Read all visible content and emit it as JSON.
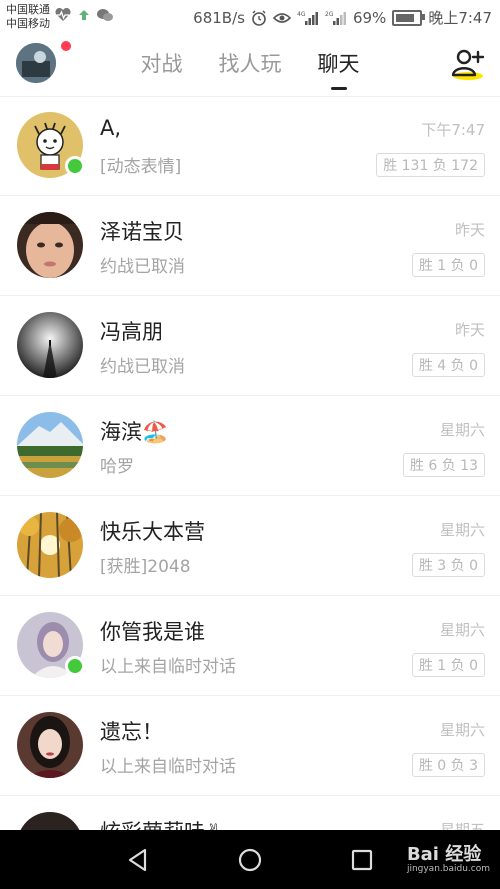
{
  "status_bar": {
    "carrier1": "中国联通",
    "carrier2": "中国移动",
    "speed": "681B/s",
    "network1": "4G",
    "network2": "2G",
    "battery_percent": "69%",
    "battery_level": 0.69,
    "time": "晚上7:47"
  },
  "tabs": [
    {
      "label": "对战"
    },
    {
      "label": "找人玩"
    },
    {
      "label": "聊天"
    }
  ],
  "active_tab": "聊天",
  "chats": [
    {
      "name": "A,",
      "message": "[动态表情]",
      "time": "下午7:47",
      "record": "胜 131 负 172"
    },
    {
      "name": "泽诺宝贝",
      "message": "约战已取消",
      "time": "昨天",
      "record": "胜 1 负 0"
    },
    {
      "name": "冯高朋",
      "message": "约战已取消",
      "time": "昨天",
      "record": "胜 4 负 0"
    },
    {
      "name": "海滨🏖️",
      "message": "哈罗",
      "time": "星期六",
      "record": "胜 6 负 13"
    },
    {
      "name": "快乐大本营",
      "message": "[获胜]2048",
      "time": "星期六",
      "record": "胜 3 负 0"
    },
    {
      "name": "你管我是谁",
      "message": "以上来自临时对话",
      "time": "星期六",
      "record": "胜 1 负 0"
    },
    {
      "name": "遗忘！",
      "message": "以上来自临时对话",
      "time": "星期六",
      "record": "胜 0 负 3"
    },
    {
      "name": "炫彩萝莉哇✌",
      "message": "",
      "time": "星期五",
      "record": ""
    }
  ],
  "watermark": {
    "brand": "Bai 经验",
    "url": "jingyan.baidu.com"
  },
  "colors": {
    "online": "#44c93a",
    "notify_dot": "#ff3b52",
    "add_icon_accent": "#ffe400"
  },
  "icons": {
    "add_friend": "add-user-icon",
    "back": "back-triangle-icon",
    "home": "home-circle-icon",
    "recents": "recents-square-icon"
  }
}
